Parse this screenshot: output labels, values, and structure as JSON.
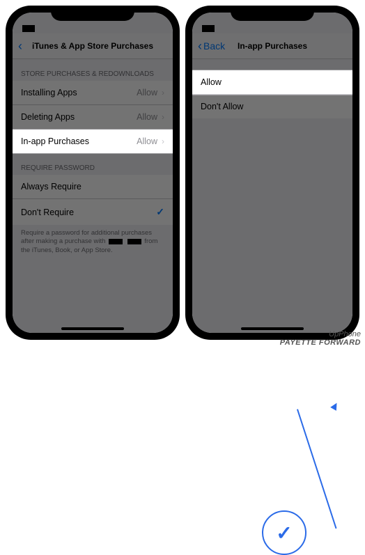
{
  "phone1": {
    "nav": {
      "title": "iTunes & App Store Purchases",
      "back_label": ""
    },
    "section1": {
      "header": "STORE PURCHASES & REDOWNLOADS",
      "rows": [
        {
          "label": "Installing Apps",
          "value": "Allow"
        },
        {
          "label": "Deleting Apps",
          "value": "Allow"
        },
        {
          "label": "In-app Purchases",
          "value": "Allow"
        }
      ]
    },
    "section2": {
      "header": "REQUIRE PASSWORD",
      "rows": [
        {
          "label": "Always Require",
          "selected": false
        },
        {
          "label": "Don't Require",
          "selected": true
        }
      ],
      "footer_prefix": "Require a password for additional purchases after making a purchase with",
      "footer_suffix": "from the iTunes, Book, or App Store."
    }
  },
  "phone2": {
    "nav": {
      "title": "In-app Purchases",
      "back_label": "Back"
    },
    "rows": [
      {
        "label": "Allow",
        "selected": true
      },
      {
        "label": "Don't Allow",
        "selected": false
      }
    ]
  },
  "watermark": {
    "line1": "UpPhone",
    "line2": "PAYETTE FORWARD"
  },
  "glyphs": {
    "check": "✓",
    "chevron": "›",
    "back": "‹"
  }
}
